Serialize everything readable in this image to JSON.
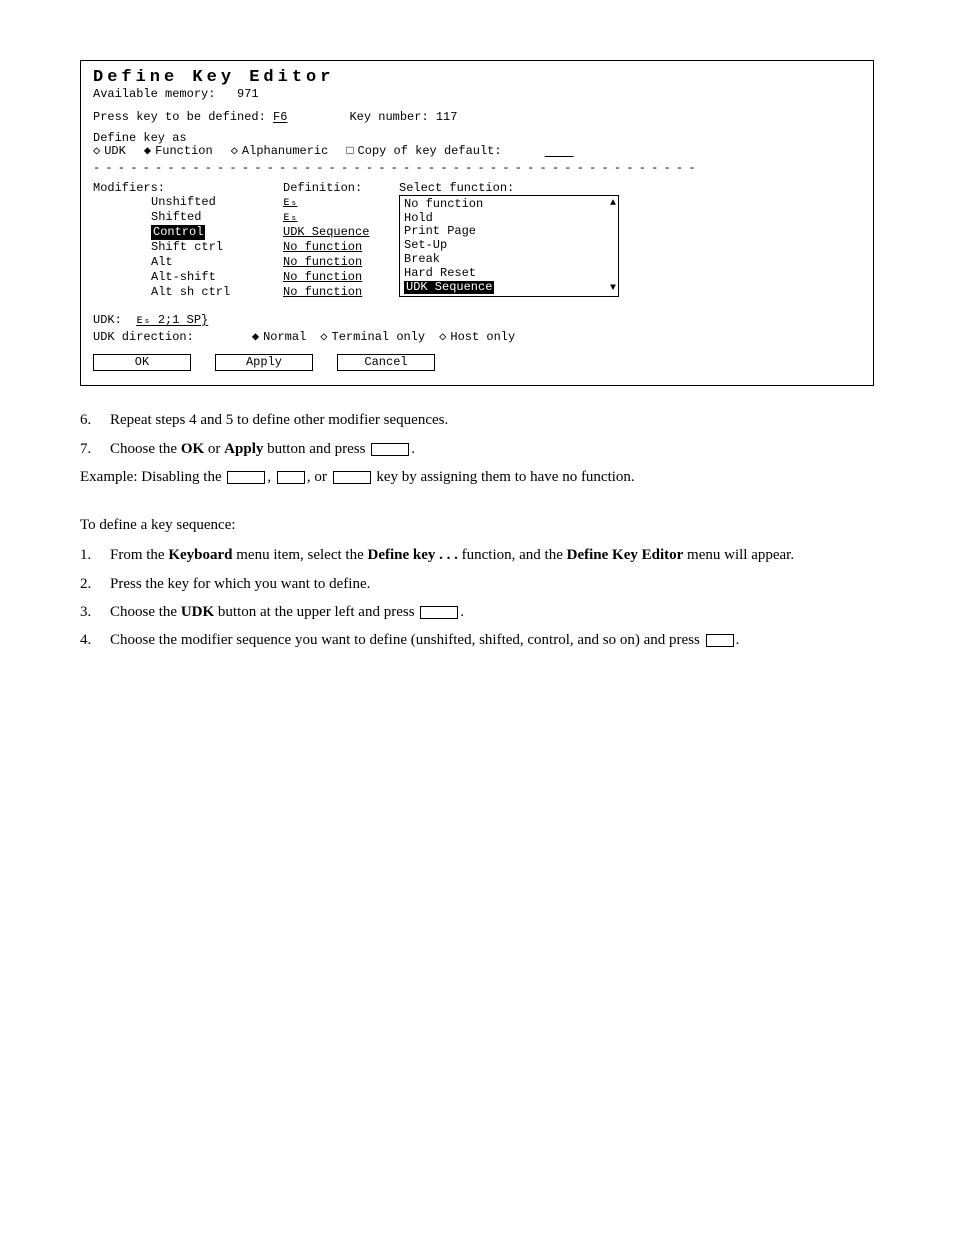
{
  "editor": {
    "title": "Define Key Editor",
    "available_memory_label": "Available memory:",
    "available_memory_value": "971",
    "press_key_label": "Press key to be defined:",
    "press_key_value": "F6",
    "key_number_label": "Key number:",
    "key_number_value": "117",
    "define_key_as_label": "Define key as",
    "radio_udk": "UDK",
    "radio_function": "Function",
    "radio_alpha": "Alphanumeric",
    "check_copy": "Copy of key default:",
    "modifiers_label": "Modifiers:",
    "modifiers": {
      "unshifted": "Unshifted",
      "shifted": "Shifted",
      "control": "Control",
      "shift_ctrl": "Shift ctrl",
      "alt": "Alt",
      "alt_shift": "Alt-shift",
      "alt_sh_ctrl": "Alt sh ctrl"
    },
    "definition_label": "Definition:",
    "definitions": {
      "d1": "ᴇₛ",
      "d2": "ᴇₛ",
      "d3": "UDK Sequence",
      "d4": "No function",
      "d5": "No function",
      "d6": "No function",
      "d7": "No function"
    },
    "select_function_label": "Select function:",
    "functions": {
      "f1": "No function",
      "f2": "Hold",
      "f3": "Print Page",
      "f4": "Set-Up",
      "f5": "Break",
      "f6": "Hard Reset",
      "f7": "UDK Sequence"
    },
    "udk_label": "UDK:",
    "udk_value": "ᴇₛ 2;1 SP}",
    "udk_direction_label": "UDK direction:",
    "dir_normal": "Normal",
    "dir_terminal": "Terminal only",
    "dir_host": "Host only",
    "btn_ok": "OK",
    "btn_apply": "Apply",
    "btn_cancel": "Cancel"
  },
  "doc": {
    "step6_num": "6.",
    "step6": "Repeat steps 4 and 5 to define other modifier sequences.",
    "step7_num": "7.",
    "step7_a": "Choose the ",
    "step7_ok": "OK",
    "step7_mid": " or ",
    "step7_apply": "Apply",
    "step7_b": " button and press ",
    "example_a": "Example: Disabling the ",
    "example_mid1": ", ",
    "example_mid2": ", or ",
    "example_b": " key by assigning them to have no function.",
    "define_seq": "To define a key sequence:",
    "l1_num": "1.",
    "l1_a": "From the ",
    "l1_kbd": "Keyboard",
    "l1_b": " menu item, select the ",
    "l1_def": "Define key . . .",
    "l1_c": " function, and the ",
    "l1_dke": "Define Key Editor",
    "l1_d": " menu will appear.",
    "l2_num": "2.",
    "l2": "Press the key for which you want to define.",
    "l3_num": "3.",
    "l3_a": "Choose the ",
    "l3_udk": "UDK",
    "l3_b": " button at the upper left and press ",
    "l4_num": "4.",
    "l4_a": "Choose the modifier sequence you want to define (unshifted, shifted, control, and so on) and press "
  }
}
